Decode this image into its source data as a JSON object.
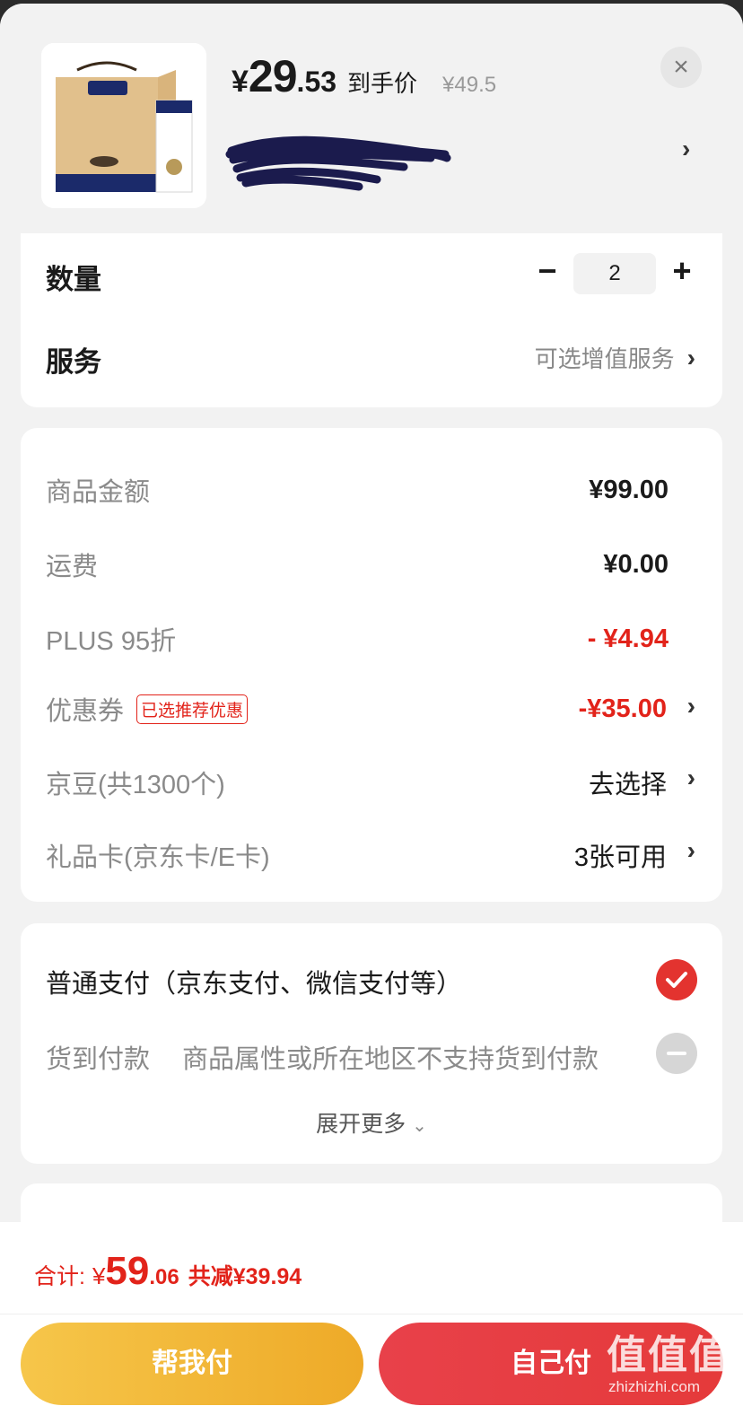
{
  "product": {
    "price_symbol": "¥",
    "price_int": "29",
    "price_dec": ".53",
    "price_label": "到手价",
    "original_price": "¥49.5",
    "close_icon": "close-icon",
    "image_text": "纯牛奶",
    "image_brand": "特仑苏"
  },
  "quantity": {
    "label": "数量",
    "value": "2",
    "minus": "−",
    "plus": "+"
  },
  "service": {
    "label": "服务",
    "value": "可选增值服务"
  },
  "summary": {
    "goods_amount": {
      "label": "商品金额",
      "value": "¥99.00"
    },
    "shipping": {
      "label": "运费",
      "value": "¥0.00"
    },
    "plus": {
      "label": "PLUS 95折",
      "value": "- ¥4.94"
    },
    "coupon": {
      "label": "优惠券",
      "tag": "已选推荐优惠",
      "value": "-¥35.00"
    },
    "jingdou": {
      "label": "京豆(共1300个)",
      "value": "去选择"
    },
    "giftcard": {
      "label": "礼品卡(京东卡/E卡)",
      "value": "3张可用"
    }
  },
  "payment": {
    "normal": "普通支付（京东支付、微信支付等）",
    "cod_label": "货到付款",
    "cod_note": "商品属性或所在地区不支持货到付款",
    "expand": "展开更多"
  },
  "footer": {
    "total_label": "合计:",
    "total_symbol": "¥",
    "total_int": "59",
    "total_dec": ".06",
    "total_saved": "共减¥39.94",
    "help_pay": "帮我付",
    "self_pay": "自己付"
  },
  "watermark": {
    "text": "值值值",
    "url": "zhizhizhi.com"
  },
  "colors": {
    "accent_red": "#e2231a",
    "help_btn": "#f2b83a",
    "self_btn": "#e6403f"
  }
}
